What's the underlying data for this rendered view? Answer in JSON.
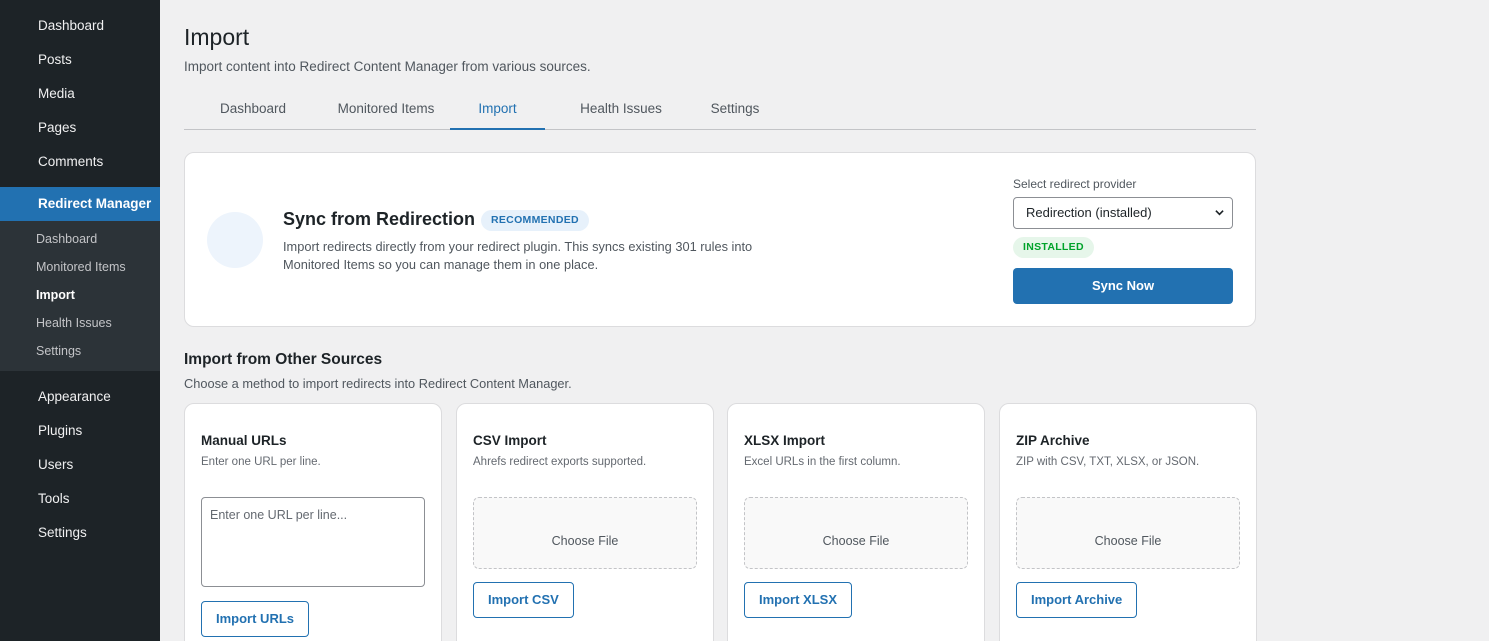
{
  "sidebar": {
    "top_items": [
      "Dashboard",
      "Posts",
      "Media",
      "Pages",
      "Comments"
    ],
    "active_item": "Redirect Manager",
    "sub_items": [
      "Dashboard",
      "Monitored Items",
      "Import",
      "Health Issues",
      "Settings"
    ],
    "current_sub": "Import",
    "bottom_items": [
      "Appearance",
      "Plugins",
      "Users",
      "Tools",
      "Settings"
    ]
  },
  "header": {
    "title": "Import",
    "subtitle": "Import content into Redirect Content Manager from various sources."
  },
  "tabs": [
    "Dashboard",
    "Monitored Items",
    "Import",
    "Health Issues",
    "Settings"
  ],
  "active_tab": "Import",
  "sync": {
    "title": "Sync from Redirection",
    "badge": "RECOMMENDED",
    "description": "Import redirects directly from your redirect plugin. This syncs existing 301 rules into Monitored Items so you can manage them in one place.",
    "provider_label": "Select redirect provider",
    "provider_value": "Redirection (installed)",
    "status_badge": "INSTALLED",
    "button": "Sync Now"
  },
  "other": {
    "title": "Import from Other Sources",
    "subtitle": "Choose a method to import redirects into Redirect Content Manager.",
    "cards": [
      {
        "title": "Manual URLs",
        "desc": "Enter one URL per line.",
        "placeholder": "Enter one URL per line...",
        "button": "Import URLs"
      },
      {
        "title": "CSV Import",
        "desc": "Ahrefs redirect exports supported.",
        "file_label": "Choose File",
        "button": "Import CSV"
      },
      {
        "title": "XLSX Import",
        "desc": "Excel URLs in the first column.",
        "file_label": "Choose File",
        "button": "Import XLSX"
      },
      {
        "title": "ZIP Archive",
        "desc": "ZIP with CSV, TXT, XLSX, or JSON.",
        "file_label": "Choose File",
        "button": "Import Archive"
      }
    ]
  },
  "colors": {
    "accent": "#2271b1",
    "sidebar_bg": "#1d2327",
    "success": "#00a32a"
  }
}
